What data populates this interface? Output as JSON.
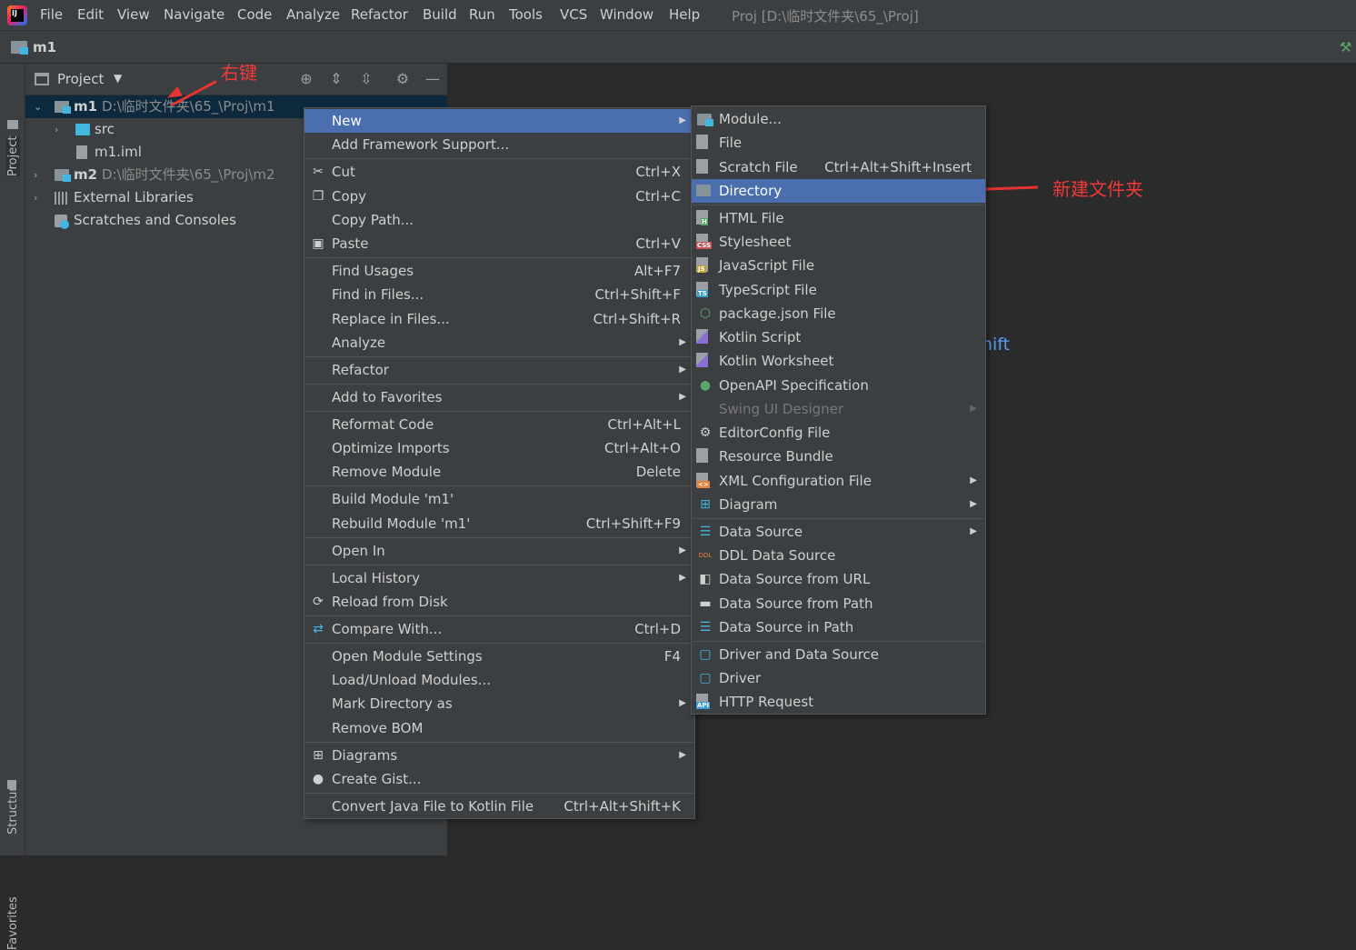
{
  "menubar": {
    "items": [
      "File",
      "Edit",
      "View",
      "Navigate",
      "Code",
      "Analyze",
      "Refactor",
      "Build",
      "Run",
      "Tools",
      "VCS",
      "Window",
      "Help"
    ],
    "window_title": "Proj [D:\\临时文件夹\\65_\\Proj]"
  },
  "navbar": {
    "crumb": "m1"
  },
  "side_tabs": {
    "project": "Project",
    "structure": "Structure",
    "favorites": "Favorites"
  },
  "panel": {
    "title": "Project"
  },
  "annotations": {
    "right_click": "右键",
    "new_folder": "新建文件夹"
  },
  "tree": [
    {
      "label": "m1",
      "path": "D:\\临时文件夹\\65_\\Proj\\m1"
    },
    {
      "label": "src"
    },
    {
      "label": "m1.iml"
    },
    {
      "label": "m2",
      "path": "D:\\临时文件夹\\65_\\Proj\\m2"
    },
    {
      "label": "External Libraries"
    },
    {
      "label": "Scratches and Consoles"
    }
  ],
  "editor": {
    "hint_fragment": "hift"
  },
  "context_menu": [
    {
      "label": "New",
      "shortcut": "",
      "submenu": true,
      "icon": ""
    },
    {
      "label": "Add Framework Support...",
      "shortcut": ""
    },
    {
      "label": "Cut",
      "shortcut": "Ctrl+X",
      "icon": "scissors-icon"
    },
    {
      "label": "Copy",
      "shortcut": "Ctrl+C",
      "icon": "copy-icon"
    },
    {
      "label": "Copy Path...",
      "shortcut": ""
    },
    {
      "label": "Paste",
      "shortcut": "Ctrl+V",
      "icon": "clipboard-icon"
    },
    {
      "label": "Find Usages",
      "shortcut": "Alt+F7"
    },
    {
      "label": "Find in Files...",
      "shortcut": "Ctrl+Shift+F"
    },
    {
      "label": "Replace in Files...",
      "shortcut": "Ctrl+Shift+R"
    },
    {
      "label": "Analyze",
      "shortcut": "",
      "submenu": true
    },
    {
      "label": "Refactor",
      "shortcut": "",
      "submenu": true
    },
    {
      "label": "Add to Favorites",
      "shortcut": "",
      "submenu": true
    },
    {
      "label": "Reformat Code",
      "shortcut": "Ctrl+Alt+L"
    },
    {
      "label": "Optimize Imports",
      "shortcut": "Ctrl+Alt+O"
    },
    {
      "label": "Remove Module",
      "shortcut": "Delete"
    },
    {
      "label": "Build Module 'm1'",
      "shortcut": ""
    },
    {
      "label": "Rebuild Module 'm1'",
      "shortcut": "Ctrl+Shift+F9"
    },
    {
      "label": "Open In",
      "shortcut": "",
      "submenu": true
    },
    {
      "label": "Local History",
      "shortcut": "",
      "submenu": true
    },
    {
      "label": "Reload from Disk",
      "shortcut": "",
      "icon": "reload-icon"
    },
    {
      "label": "Compare With...",
      "shortcut": "Ctrl+D",
      "icon": "compare-icon"
    },
    {
      "label": "Open Module Settings",
      "shortcut": "F4"
    },
    {
      "label": "Load/Unload Modules...",
      "shortcut": ""
    },
    {
      "label": "Mark Directory as",
      "shortcut": "",
      "submenu": true
    },
    {
      "label": "Remove BOM",
      "shortcut": ""
    },
    {
      "label": "Diagrams",
      "shortcut": "",
      "submenu": true,
      "icon": "diagram-icon"
    },
    {
      "label": "Create Gist...",
      "shortcut": "",
      "icon": "github-icon"
    },
    {
      "label": "Convert Java File to Kotlin File",
      "shortcut": "Ctrl+Alt+Shift+K"
    }
  ],
  "new_submenu": [
    {
      "label": "Module...",
      "shortcut": "",
      "icon": "module-icon"
    },
    {
      "label": "File",
      "shortcut": "",
      "icon": "file-icon"
    },
    {
      "label": "Scratch File",
      "shortcut": "Ctrl+Alt+Shift+Insert",
      "icon": "scratch-file-icon"
    },
    {
      "label": "Directory",
      "shortcut": "",
      "icon": "folder-icon"
    },
    {
      "label": "HTML File",
      "shortcut": "",
      "icon": "html-file-icon",
      "badge": "H"
    },
    {
      "label": "Stylesheet",
      "shortcut": "",
      "icon": "css-file-icon",
      "badge": "CSS"
    },
    {
      "label": "JavaScript File",
      "shortcut": "",
      "icon": "js-file-icon",
      "badge": "JS"
    },
    {
      "label": "TypeScript File",
      "shortcut": "",
      "icon": "ts-file-icon",
      "badge": "TS"
    },
    {
      "label": "package.json File",
      "shortcut": "",
      "icon": "nodejs-icon"
    },
    {
      "label": "Kotlin Script",
      "shortcut": "",
      "icon": "kotlin-script-icon"
    },
    {
      "label": "Kotlin Worksheet",
      "shortcut": "",
      "icon": "kotlin-worksheet-icon"
    },
    {
      "label": "OpenAPI Specification",
      "shortcut": "",
      "icon": "openapi-icon"
    },
    {
      "label": "Swing UI Designer",
      "shortcut": "",
      "submenu": true,
      "disabled": true
    },
    {
      "label": "EditorConfig File",
      "shortcut": "",
      "icon": "gear-icon"
    },
    {
      "label": "Resource Bundle",
      "shortcut": "",
      "icon": "resource-bundle-icon"
    },
    {
      "label": "XML Configuration File",
      "shortcut": "",
      "submenu": true,
      "icon": "xml-file-icon"
    },
    {
      "label": "Diagram",
      "shortcut": "",
      "submenu": true,
      "icon": "diagram-icon"
    },
    {
      "label": "Data Source",
      "shortcut": "",
      "submenu": true,
      "icon": "database-icon"
    },
    {
      "label": "DDL Data Source",
      "shortcut": "",
      "icon": "ddl-icon"
    },
    {
      "label": "Data Source from URL",
      "shortcut": "",
      "icon": "url-datasource-icon"
    },
    {
      "label": "Data Source from Path",
      "shortcut": "",
      "icon": "folder-open-icon"
    },
    {
      "label": "Data Source in Path",
      "shortcut": "",
      "icon": "database-icon"
    },
    {
      "label": "Driver and Data Source",
      "shortcut": "",
      "icon": "driver-icon"
    },
    {
      "label": "Driver",
      "shortcut": "",
      "icon": "driver-icon"
    },
    {
      "label": "HTTP Request",
      "shortcut": "",
      "icon": "api-icon",
      "badge": "API"
    }
  ],
  "colors": {
    "accent": "#4b6eaf",
    "selection": "#0d293e",
    "annotation": "#f03a3a",
    "link": "#589df6"
  }
}
